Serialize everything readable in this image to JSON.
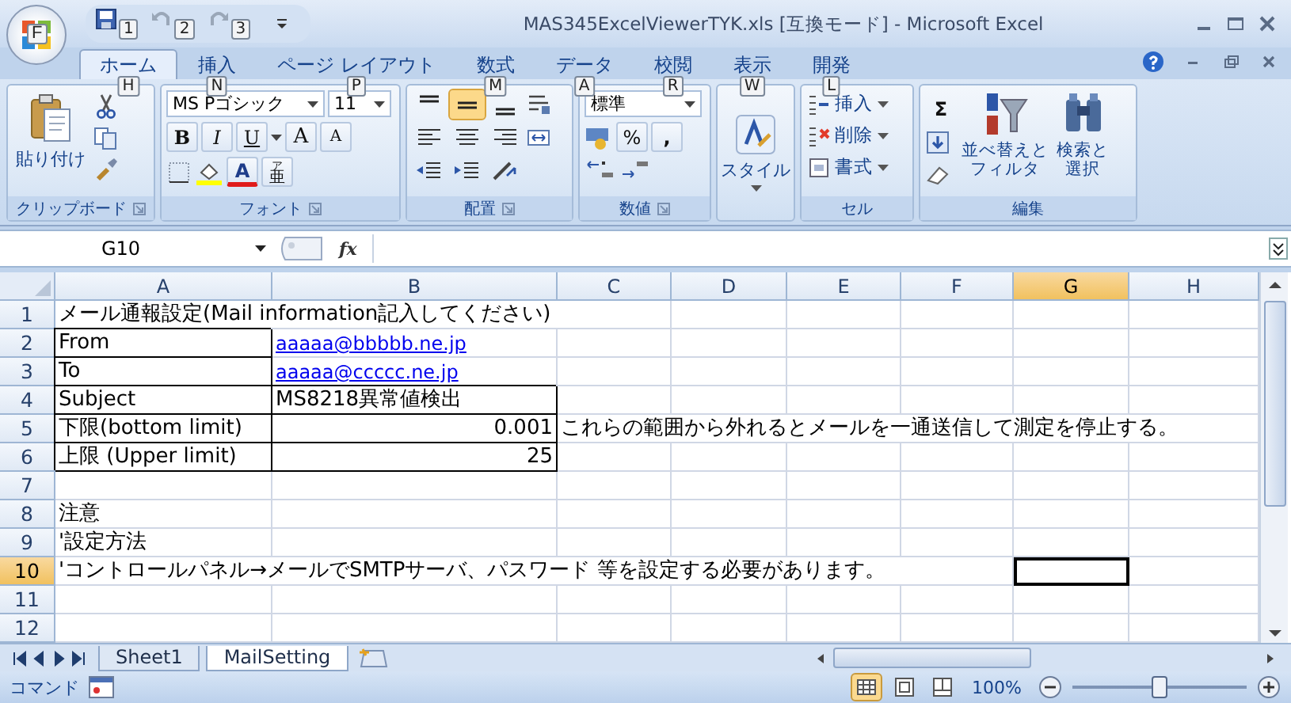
{
  "title_bar": {
    "office_keytip": "F",
    "quick_access": [
      {
        "kind": "save",
        "keytip": "1"
      },
      {
        "kind": "undo",
        "keytip": "2"
      },
      {
        "kind": "redo",
        "keytip": "3"
      }
    ],
    "title": "MAS345ExcelViewerTYK.xls  [互換モード] - Microsoft Excel"
  },
  "tabs": [
    {
      "label": "ホーム",
      "keytip": "H",
      "selected": true
    },
    {
      "label": "挿入",
      "keytip": "N",
      "selected": false
    },
    {
      "label": "ページ レイアウト",
      "keytip": "P",
      "selected": false
    },
    {
      "label": "数式",
      "keytip": "M",
      "selected": false
    },
    {
      "label": "データ",
      "keytip": "A",
      "selected": false
    },
    {
      "label": "校閲",
      "keytip": "R",
      "selected": false
    },
    {
      "label": "表示",
      "keytip": "W",
      "selected": false
    },
    {
      "label": "開発",
      "keytip": "L",
      "selected": false
    }
  ],
  "ribbon": {
    "clipboard": {
      "label": "クリップボード",
      "paste": "貼り付け"
    },
    "font": {
      "label": "フォント",
      "font_name": "MS Pゴシック",
      "font_size": "11",
      "bold": "B",
      "italic": "I",
      "underline": "U",
      "grow": "A",
      "shrink": "A",
      "font_color": "A",
      "phonetic": [
        "ア",
        "亜"
      ]
    },
    "alignment": {
      "label": "配置",
      "vertical": [
        {
          "selected": false
        },
        {
          "selected": true
        },
        {
          "selected": false
        }
      ]
    },
    "number": {
      "label": "数値",
      "format": "標準",
      "percent": "%",
      "comma": ","
    },
    "styles": {
      "label": "スタイル"
    },
    "cells": {
      "label": "セル",
      "buttons": [
        {
          "kind": "insert",
          "label": "挿入"
        },
        {
          "kind": "delete",
          "label": "削除"
        },
        {
          "kind": "format",
          "label": "書式"
        }
      ]
    },
    "editing": {
      "label": "編集",
      "sum": "Σ",
      "sort": [
        "並べ替えと",
        "フィルタ"
      ],
      "find": [
        "検索と",
        "選択"
      ]
    }
  },
  "formula_bar": {
    "name_box": "G10",
    "fx": "fx"
  },
  "columns": [
    {
      "label": "A",
      "selected": false
    },
    {
      "label": "B",
      "selected": false
    },
    {
      "label": "C",
      "selected": false
    },
    {
      "label": "D",
      "selected": false
    },
    {
      "label": "E",
      "selected": false
    },
    {
      "label": "F",
      "selected": false
    },
    {
      "label": "G",
      "selected": true
    },
    {
      "label": "H",
      "selected": false
    }
  ],
  "rows": [
    {
      "number": "1",
      "selected": false,
      "cells": {
        "A": {
          "text": "メール通報設定(Mail information記入してください)",
          "kind": "text",
          "bordered": false
        }
      }
    },
    {
      "number": "2",
      "selected": false,
      "cells": {
        "A": {
          "text": "From",
          "kind": "text",
          "bordered": true
        },
        "B": {
          "text": "aaaaa@bbbbb.ne.jp",
          "kind": "link",
          "bordered": false
        }
      }
    },
    {
      "number": "3",
      "selected": false,
      "cells": {
        "A": {
          "text": "To",
          "kind": "text",
          "bordered": true
        },
        "B": {
          "text": "aaaaa@ccccc.ne.jp",
          "kind": "link",
          "bordered": false
        }
      }
    },
    {
      "number": "4",
      "selected": false,
      "cells": {
        "A": {
          "text": "Subject",
          "kind": "text",
          "bordered": true
        },
        "B": {
          "text": "MS8218異常値検出",
          "kind": "text",
          "bordered": true
        }
      }
    },
    {
      "number": "5",
      "selected": false,
      "cells": {
        "A": {
          "text": "下限(bottom limit)",
          "kind": "text",
          "bordered": true
        },
        "B": {
          "text": "0.001",
          "kind": "number",
          "bordered": true
        },
        "C": {
          "text": "これらの範囲から外れるとメールを一通送信して測定を停止する。",
          "kind": "text",
          "bordered": false
        }
      }
    },
    {
      "number": "6",
      "selected": false,
      "cells": {
        "A": {
          "text": "上限 (Upper limit)",
          "kind": "text",
          "bordered": true
        },
        "B": {
          "text": "25",
          "kind": "number",
          "bordered": true
        }
      }
    },
    {
      "number": "7",
      "selected": false
    },
    {
      "number": "8",
      "selected": false,
      "cells": {
        "A": {
          "text": "注意",
          "kind": "text",
          "bordered": false
        }
      }
    },
    {
      "number": "9",
      "selected": false,
      "cells": {
        "A": {
          "text": "'設定方法",
          "kind": "text",
          "bordered": false
        }
      }
    },
    {
      "number": "10",
      "selected": true,
      "cells": {
        "A": {
          "text": "'コントロールパネル→メールでSMTPサーバ、パスワード 等を設定する必要があります。",
          "kind": "text",
          "bordered": false
        }
      }
    },
    {
      "number": "11",
      "selected": false
    },
    {
      "number": "12",
      "selected": false
    }
  ],
  "sheet_tabs": [
    {
      "label": "Sheet1",
      "selected": false
    },
    {
      "label": "MailSetting",
      "selected": true
    }
  ],
  "status_bar": {
    "mode": "コマンド",
    "views": [
      {
        "kind": "normal",
        "selected": true
      },
      {
        "kind": "layout",
        "selected": false
      },
      {
        "kind": "pagebreak",
        "selected": false
      }
    ],
    "zoom": "100%",
    "zoom_slider": {
      "level": 0.5
    }
  }
}
